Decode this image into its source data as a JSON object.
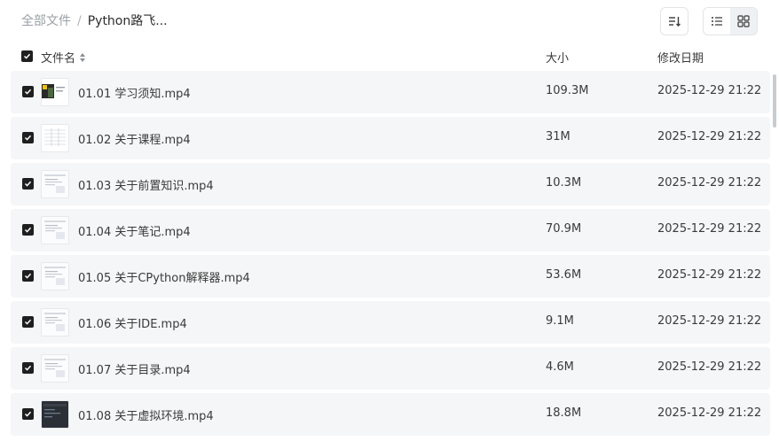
{
  "breadcrumb": {
    "root": "全部文件",
    "separator": "/",
    "current": "Python路飞..."
  },
  "toolbar": {
    "sort_icon": "sort-icon",
    "list_view_icon": "list-view-icon",
    "grid_view_icon": "grid-view-icon",
    "active_view": "list"
  },
  "table": {
    "headers": {
      "name": "文件名",
      "size": "大小",
      "date": "修改日期"
    },
    "all_selected": true,
    "rows": [
      {
        "name": "01.01 学习须知.mp4",
        "size": "109.3M",
        "date": "2025-12-29 21:22",
        "checked": true,
        "thumb": "video-thumbnail-slides-yellow"
      },
      {
        "name": "01.02 关于课程.mp4",
        "size": "31M",
        "date": "2025-12-29 21:22",
        "checked": true,
        "thumb": "video-thumbnail-table"
      },
      {
        "name": "01.03 关于前置知识.mp4",
        "size": "10.3M",
        "date": "2025-12-29 21:22",
        "checked": true,
        "thumb": "video-thumbnail-doc"
      },
      {
        "name": "01.04 关于笔记.mp4",
        "size": "70.9M",
        "date": "2025-12-29 21:22",
        "checked": true,
        "thumb": "video-thumbnail-doc"
      },
      {
        "name": "01.05 关于CPython解释器.mp4",
        "size": "53.6M",
        "date": "2025-12-29 21:22",
        "checked": true,
        "thumb": "video-thumbnail-doc"
      },
      {
        "name": "01.06 关于IDE.mp4",
        "size": "9.1M",
        "date": "2025-12-29 21:22",
        "checked": true,
        "thumb": "video-thumbnail-doc"
      },
      {
        "name": "01.07 关于目录.mp4",
        "size": "4.6M",
        "date": "2025-12-29 21:22",
        "checked": true,
        "thumb": "video-thumbnail-doc"
      },
      {
        "name": "01.08 关于虚拟环境.mp4",
        "size": "18.8M",
        "date": "2025-12-29 21:22",
        "checked": true,
        "thumb": "video-thumbnail-dark-ide"
      }
    ]
  },
  "colors": {
    "row_bg": "#f5f6f7",
    "checkbox": "#1f1f1f",
    "muted_text": "#9aa0a6"
  }
}
